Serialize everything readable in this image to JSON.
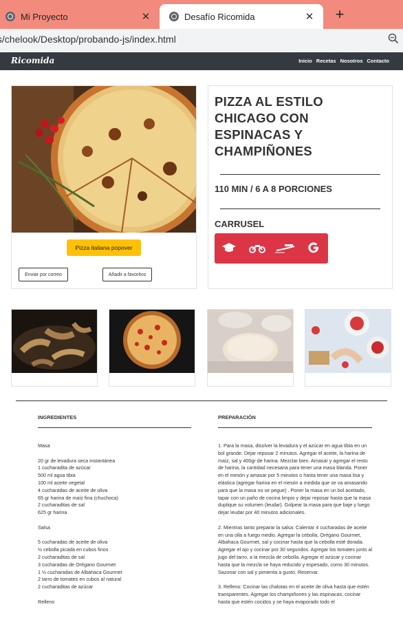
{
  "browser": {
    "tabs": [
      {
        "title": "Mi Proyecto"
      },
      {
        "title": "Desafío Ricomida"
      }
    ],
    "url": "/s/chelook/Desktop/probando-js/index.html"
  },
  "nav": {
    "brand": "Ricomida",
    "links": [
      "Inicio",
      "Recetas",
      "Nosotros",
      "Contacto"
    ]
  },
  "recipe": {
    "title": "PIZZA AL ESTILO CHICAGO CON ESPINACAS Y CHAMPIÑONES",
    "time": "110 MIN / 6 A 8 PORCIONES",
    "popover_btn": "Pizza italiana popover",
    "email_btn": "Enviar por correo",
    "fav_btn": "Añadir a favoritos",
    "carousel_title": "CARRUSEL",
    "carousel_icons": [
      "graduation-cap-icon",
      "motorcycle-icon",
      "brand-logo-icon",
      "google-icon"
    ]
  },
  "ingredients": {
    "heading": "INGREDIENTES",
    "text": "Masa\n\n20 gr de levadura seca instantánea\n1 cucharadita de azúcar\n500 ml agua tibia\n100 ml aceite vegetal\n4 cucharadas de aceite de oliva\n65 gr harina de maíz fina (chuchoca)\n2 cucharaditas de sal\n625 gr harina\n\nSalsa\n\n5 cucharadas de aceite de oliva\n½ cebolla picada en cubos finos\n2 cucharaditas de sal\n3 cucharadas de Orégano Gourmet\n1 ½ cucharadas de Albahaca Gourmet\n2 tarro de tomates en cubos al natural\n2 cucharaditas de azúcar\n\nRelleno"
  },
  "preparation": {
    "heading": "PREPARACIÓN",
    "paragraphs": [
      "1. Para la masa, disolver la levadura y el azúcar en agua tibia en un bol grande. Dejar reposar 2 minutos. Agregar el aceite, la harina de maíz, sal y 400gr de harina. Mezclar bien. Amasar y agregar el resto de harina, la cantidad necesaria para tener una masa blanda. Poner en el mesón y amasar por 5 minutos o hasta tener una masa lisa y elástica (agregar harina en el mesón a medida que se va amasando para que la masa no se pegue) . Poner la masa en un bol aceitado, tapar con un paño de cocina limpio y dejar reposar hasta que la masa duplique su volumen (leudar). Golpear la masa para que baje y luego dejar leudar por 40 minutos adicionales.",
      "2. Mientras tanto preparar la salsa: Calentar 4 cucharadas de aceite en una olla a fuego medio. Agregar la cebolla, Orégano Gourmet, Albahaca Gourmet, sal y cocinar hasta que la cebolla esté dorada. Agregar el ajo y cocinar por 30 segundos. Agregar los tomates junto al jugo del tarro, a la mezcla de cebolla. Agregar el azúcar y cocinar hasta que la mezcla se haya reducido y espesado, como 30 minutos. Sazonar con sal y pimienta a gusto. Reservar.",
      "3. Relleno: Cocinar las chalotas en el aceite de oliva hasta que estén transparentes. Agregar los champiñones y las espinacas, cocinar hasta que estén cocidos y se haya evaporado todo el"
    ]
  }
}
